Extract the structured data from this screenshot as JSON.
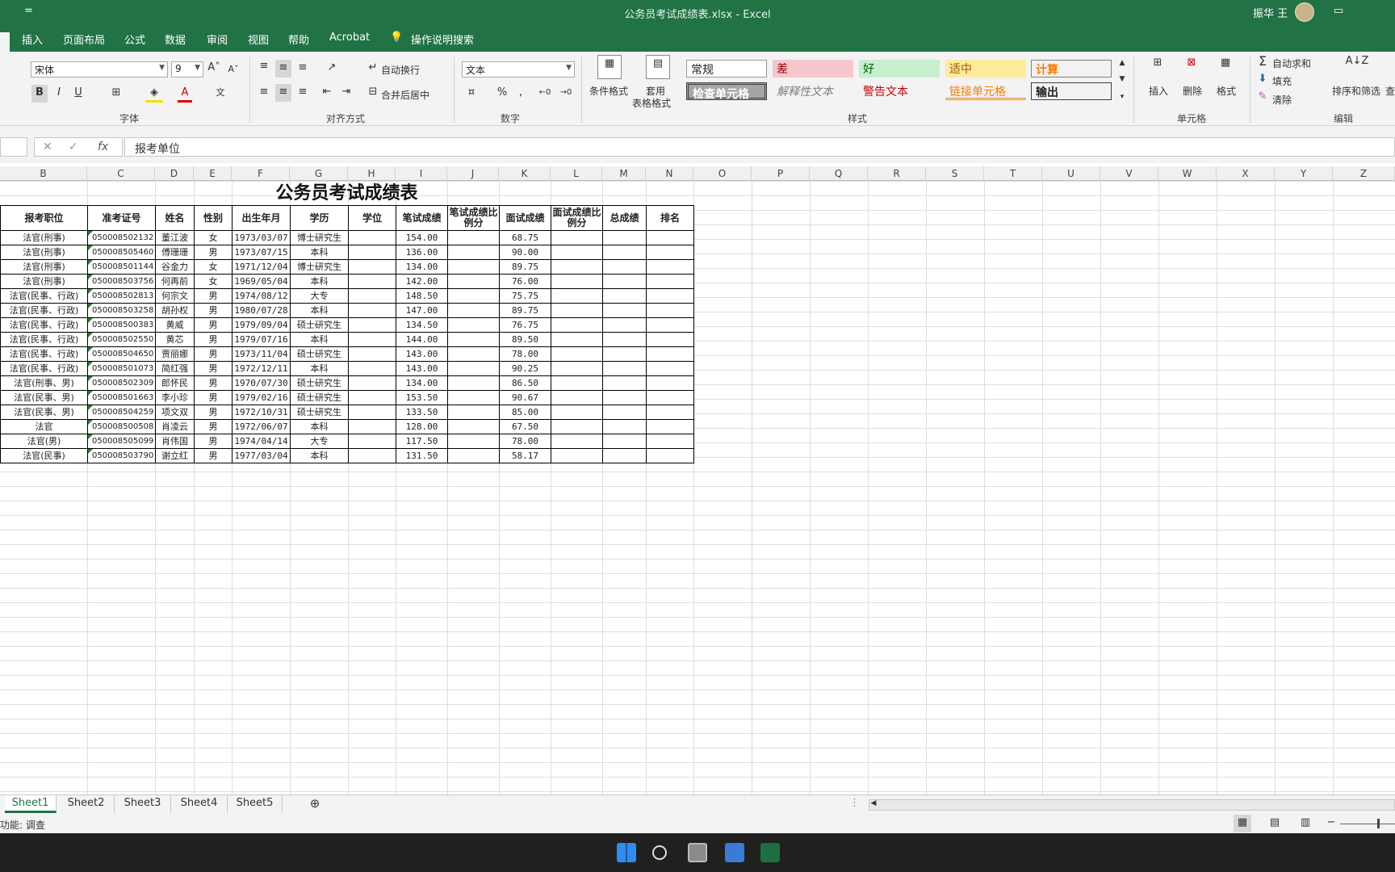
{
  "window": {
    "doc_title": "公务员考试成绩表.xlsx  -  Excel",
    "user": "振华 王",
    "qat": "="
  },
  "tabs": [
    "插入",
    "页面布局",
    "公式",
    "数据",
    "审阅",
    "视图",
    "帮助",
    "Acrobat"
  ],
  "tell_me": "操作说明搜索",
  "ribbon": {
    "font_name": "宋体",
    "font_size": "9",
    "bold": "B",
    "italic": "I",
    "underline": "U",
    "wrap_text": "自动换行",
    "merge_center": "合并后居中",
    "number_format": "文本",
    "percent": "%",
    "comma": ",",
    "cond_format": "条件格式",
    "table_format_1": "套用",
    "table_format_2": "表格格式",
    "styles": [
      "常规",
      "差",
      "好",
      "适中",
      "计算",
      "检查单元格",
      "解释性文本",
      "警告文本",
      "链接单元格",
      "输出"
    ],
    "insert": "插入",
    "delete": "删除",
    "format": "格式",
    "autosum": "自动求和",
    "fill": "填充",
    "clear": "清除",
    "sort_filter": "排序和筛选",
    "find": "查",
    "groups": {
      "font": "字体",
      "align": "对齐方式",
      "number": "数字",
      "styles": "样式",
      "cells": "单元格",
      "editing": "编辑"
    }
  },
  "formula_bar": {
    "fx": "fx",
    "content": "报考单位"
  },
  "columns": [
    "B",
    "C",
    "D",
    "E",
    "F",
    "G",
    "H",
    "I",
    "J",
    "K",
    "L",
    "M",
    "N",
    "O",
    "P",
    "Q",
    "R",
    "S",
    "T",
    "U",
    "V",
    "W",
    "X",
    "Y",
    "Z"
  ],
  "sheet": {
    "title": "公务员考试成绩表",
    "headers": [
      "报考职位",
      "准考证号",
      "姓名",
      "性别",
      "出生年月",
      "学历",
      "学位",
      "笔试成绩",
      "笔试成绩比例分",
      "面试成绩",
      "面试成绩比例分",
      "总成绩",
      "排名"
    ],
    "rows": [
      [
        "法官(刑事)",
        "050008502132",
        "董江波",
        "女",
        "1973/03/07",
        "博士研究生",
        "",
        "154.00",
        "",
        "68.75",
        "",
        "",
        ""
      ],
      [
        "法官(刑事)",
        "050008505460",
        "傅珊珊",
        "男",
        "1973/07/15",
        "本科",
        "",
        "136.00",
        "",
        "90.00",
        "",
        "",
        ""
      ],
      [
        "法官(刑事)",
        "050008501144",
        "谷金力",
        "女",
        "1971/12/04",
        "博士研究生",
        "",
        "134.00",
        "",
        "89.75",
        "",
        "",
        ""
      ],
      [
        "法官(刑事)",
        "050008503756",
        "何再前",
        "女",
        "1969/05/04",
        "本科",
        "",
        "142.00",
        "",
        "76.00",
        "",
        "",
        ""
      ],
      [
        "法官(民事、行政)",
        "050008502813",
        "何宗文",
        "男",
        "1974/08/12",
        "大专",
        "",
        "148.50",
        "",
        "75.75",
        "",
        "",
        ""
      ],
      [
        "法官(民事、行政)",
        "050008503258",
        "胡孙权",
        "男",
        "1980/07/28",
        "本科",
        "",
        "147.00",
        "",
        "89.75",
        "",
        "",
        ""
      ],
      [
        "法官(民事、行政)",
        "050008500383",
        "黄威",
        "男",
        "1979/09/04",
        "硕士研究生",
        "",
        "134.50",
        "",
        "76.75",
        "",
        "",
        ""
      ],
      [
        "法官(民事、行政)",
        "050008502550",
        "黄芯",
        "男",
        "1979/07/16",
        "本科",
        "",
        "144.00",
        "",
        "89.50",
        "",
        "",
        ""
      ],
      [
        "法官(民事、行政)",
        "050008504650",
        "贾丽娜",
        "男",
        "1973/11/04",
        "硕士研究生",
        "",
        "143.00",
        "",
        "78.00",
        "",
        "",
        ""
      ],
      [
        "法官(民事、行政)",
        "050008501073",
        "简红强",
        "男",
        "1972/12/11",
        "本科",
        "",
        "143.00",
        "",
        "90.25",
        "",
        "",
        ""
      ],
      [
        "法官(刑事、男)",
        "050008502309",
        "郎怀民",
        "男",
        "1970/07/30",
        "硕士研究生",
        "",
        "134.00",
        "",
        "86.50",
        "",
        "",
        ""
      ],
      [
        "法官(民事、男)",
        "050008501663",
        "李小珍",
        "男",
        "1979/02/16",
        "硕士研究生",
        "",
        "153.50",
        "",
        "90.67",
        "",
        "",
        ""
      ],
      [
        "法官(民事、男)",
        "050008504259",
        "项文双",
        "男",
        "1972/10/31",
        "硕士研究生",
        "",
        "133.50",
        "",
        "85.00",
        "",
        "",
        ""
      ],
      [
        "法官",
        "050008500508",
        "肖凌云",
        "男",
        "1972/06/07",
        "本科",
        "",
        "128.00",
        "",
        "67.50",
        "",
        "",
        ""
      ],
      [
        "法官(男)",
        "050008505099",
        "肖伟国",
        "男",
        "1974/04/14",
        "大专",
        "",
        "117.50",
        "",
        "78.00",
        "",
        "",
        ""
      ],
      [
        "法官(民事)",
        "050008503790",
        "谢立红",
        "男",
        "1977/03/04",
        "本科",
        "",
        "131.50",
        "",
        "58.17",
        "",
        "",
        ""
      ]
    ]
  },
  "sheet_tabs": [
    "Sheet1",
    "Sheet2",
    "Sheet3",
    "Sheet4",
    "Sheet5"
  ],
  "status": "功能: 调查",
  "colors": {
    "excel_green": "#217346",
    "taskbar": "#202020"
  }
}
